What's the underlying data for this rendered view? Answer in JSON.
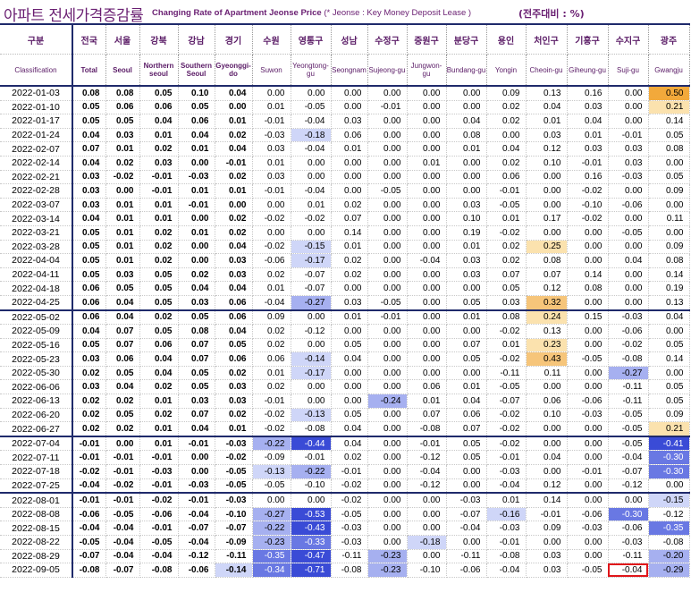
{
  "title": {
    "korean": "아파트 전세가격증감률",
    "english": "Changing Rate of Apartment Jeonse Price",
    "note": "(* Jeonse : Key Money Deposit Lease )",
    "unit": "(전주대비 : %)"
  },
  "columns": [
    {
      "ko": "구분",
      "en": "Classification"
    },
    {
      "ko": "전국",
      "en": "Total"
    },
    {
      "ko": "서울",
      "en": "Seoul"
    },
    {
      "ko": "강북",
      "en": "Northern seoul"
    },
    {
      "ko": "강남",
      "en": "Southern Seoul"
    },
    {
      "ko": "경기",
      "en": "Gyeonggi-do"
    },
    {
      "ko": "수원",
      "en": "Suwon"
    },
    {
      "ko": "영통구",
      "en": "Yeongtong-gu"
    },
    {
      "ko": "성남",
      "en": "Seongnam"
    },
    {
      "ko": "수정구",
      "en": "Sujeong-gu"
    },
    {
      "ko": "중원구",
      "en": "Jungwon-gu"
    },
    {
      "ko": "분당구",
      "en": "Bundang-gu"
    },
    {
      "ko": "용인",
      "en": "Yongin"
    },
    {
      "ko": "처인구",
      "en": "Cheoin-gu"
    },
    {
      "ko": "기흥구",
      "en": "Giheung-gu"
    },
    {
      "ko": "수지구",
      "en": "Suji-gu"
    },
    {
      "ko": "광주",
      "en": "Gwangju"
    }
  ],
  "rows": [
    [
      "2022-01-03",
      "0.08",
      "0.08",
      "0.05",
      "0.10",
      "0.04",
      "0.00",
      "0.00",
      "0.00",
      "0.00",
      "0.00",
      "0.00",
      "0.09",
      "0.13",
      "0.16",
      "0.00",
      "0.50"
    ],
    [
      "2022-01-10",
      "0.05",
      "0.06",
      "0.06",
      "0.05",
      "0.00",
      "0.01",
      "-0.05",
      "0.00",
      "-0.01",
      "0.00",
      "0.00",
      "0.02",
      "0.04",
      "0.03",
      "0.00",
      "0.21"
    ],
    [
      "2022-01-17",
      "0.05",
      "0.05",
      "0.04",
      "0.06",
      "0.01",
      "-0.01",
      "-0.04",
      "0.03",
      "0.00",
      "0.00",
      "0.04",
      "0.02",
      "0.01",
      "0.04",
      "0.00",
      "0.14"
    ],
    [
      "2022-01-24",
      "0.04",
      "0.03",
      "0.01",
      "0.04",
      "0.02",
      "-0.03",
      "-0.18",
      "0.06",
      "0.00",
      "0.00",
      "0.08",
      "0.00",
      "0.03",
      "0.01",
      "-0.01",
      "0.05"
    ],
    [
      "2022-02-07",
      "0.07",
      "0.01",
      "0.02",
      "0.01",
      "0.04",
      "0.03",
      "-0.04",
      "0.01",
      "0.00",
      "0.00",
      "0.01",
      "0.04",
      "0.12",
      "0.03",
      "0.03",
      "0.08"
    ],
    [
      "2022-02-14",
      "0.04",
      "0.02",
      "0.03",
      "0.00",
      "-0.01",
      "0.01",
      "0.00",
      "0.00",
      "0.00",
      "0.01",
      "0.00",
      "0.02",
      "0.10",
      "-0.01",
      "0.03",
      "0.00"
    ],
    [
      "2022-02-21",
      "0.03",
      "-0.02",
      "-0.01",
      "-0.03",
      "0.02",
      "0.03",
      "0.00",
      "0.00",
      "0.00",
      "0.00",
      "0.00",
      "0.06",
      "0.00",
      "0.16",
      "-0.03",
      "0.05"
    ],
    [
      "2022-02-28",
      "0.03",
      "0.00",
      "-0.01",
      "0.01",
      "0.01",
      "-0.01",
      "-0.04",
      "0.00",
      "-0.05",
      "0.00",
      "0.00",
      "-0.01",
      "0.00",
      "-0.02",
      "0.00",
      "0.09"
    ],
    [
      "2022-03-07",
      "0.03",
      "0.01",
      "0.01",
      "-0.01",
      "0.00",
      "0.00",
      "0.01",
      "0.02",
      "0.00",
      "0.00",
      "0.03",
      "-0.05",
      "0.00",
      "-0.10",
      "-0.06",
      "0.00"
    ],
    [
      "2022-03-14",
      "0.04",
      "0.01",
      "0.01",
      "0.00",
      "0.02",
      "-0.02",
      "-0.02",
      "0.07",
      "0.00",
      "0.00",
      "0.10",
      "0.01",
      "0.17",
      "-0.02",
      "0.00",
      "0.11"
    ],
    [
      "2022-03-21",
      "0.05",
      "0.01",
      "0.02",
      "0.01",
      "0.02",
      "0.00",
      "0.00",
      "0.14",
      "0.00",
      "0.00",
      "0.19",
      "-0.02",
      "0.00",
      "0.00",
      "-0.05",
      "0.00"
    ],
    [
      "2022-03-28",
      "0.05",
      "0.01",
      "0.02",
      "0.00",
      "0.04",
      "-0.02",
      "-0.15",
      "0.01",
      "0.00",
      "0.00",
      "0.01",
      "0.02",
      "0.25",
      "0.00",
      "0.00",
      "0.09"
    ],
    [
      "2022-04-04",
      "0.05",
      "0.01",
      "0.02",
      "0.00",
      "0.03",
      "-0.06",
      "-0.17",
      "0.02",
      "0.00",
      "-0.04",
      "0.03",
      "0.02",
      "0.08",
      "0.00",
      "0.04",
      "0.08"
    ],
    [
      "2022-04-11",
      "0.05",
      "0.03",
      "0.05",
      "0.02",
      "0.03",
      "0.02",
      "-0.07",
      "0.02",
      "0.00",
      "0.00",
      "0.03",
      "0.07",
      "0.07",
      "0.14",
      "0.00",
      "0.14"
    ],
    [
      "2022-04-18",
      "0.06",
      "0.05",
      "0.05",
      "0.04",
      "0.04",
      "0.01",
      "-0.07",
      "0.00",
      "0.00",
      "0.00",
      "0.00",
      "0.05",
      "0.12",
      "0.08",
      "0.00",
      "0.19"
    ],
    [
      "2022-04-25",
      "0.06",
      "0.04",
      "0.05",
      "0.03",
      "0.06",
      "-0.04",
      "-0.27",
      "0.03",
      "-0.05",
      "0.00",
      "0.05",
      "0.03",
      "0.32",
      "0.00",
      "0.00",
      "0.13"
    ],
    [
      "2022-05-02",
      "0.06",
      "0.04",
      "0.02",
      "0.05",
      "0.06",
      "0.09",
      "0.00",
      "0.01",
      "-0.01",
      "0.00",
      "0.01",
      "0.08",
      "0.24",
      "0.15",
      "-0.03",
      "0.04"
    ],
    [
      "2022-05-09",
      "0.04",
      "0.07",
      "0.05",
      "0.08",
      "0.04",
      "0.02",
      "-0.12",
      "0.00",
      "0.00",
      "0.00",
      "0.00",
      "-0.02",
      "0.13",
      "0.00",
      "-0.06",
      "0.00"
    ],
    [
      "2022-05-16",
      "0.05",
      "0.07",
      "0.06",
      "0.07",
      "0.05",
      "0.02",
      "0.00",
      "0.05",
      "0.00",
      "0.00",
      "0.07",
      "0.01",
      "0.23",
      "0.00",
      "-0.02",
      "0.05"
    ],
    [
      "2022-05-23",
      "0.03",
      "0.06",
      "0.04",
      "0.07",
      "0.06",
      "0.06",
      "-0.14",
      "0.04",
      "0.00",
      "0.00",
      "0.05",
      "-0.02",
      "0.43",
      "-0.05",
      "-0.08",
      "0.14"
    ],
    [
      "2022-05-30",
      "0.02",
      "0.05",
      "0.04",
      "0.05",
      "0.02",
      "0.01",
      "-0.17",
      "0.00",
      "0.00",
      "0.00",
      "0.00",
      "-0.11",
      "0.11",
      "0.00",
      "-0.27",
      "0.00"
    ],
    [
      "2022-06-06",
      "0.03",
      "0.04",
      "0.02",
      "0.05",
      "0.03",
      "0.02",
      "0.00",
      "0.00",
      "0.00",
      "0.06",
      "0.01",
      "-0.05",
      "0.00",
      "0.00",
      "-0.11",
      "0.05"
    ],
    [
      "2022-06-13",
      "0.02",
      "0.02",
      "0.01",
      "0.03",
      "0.03",
      "-0.01",
      "0.00",
      "0.00",
      "-0.24",
      "0.01",
      "0.04",
      "-0.07",
      "0.06",
      "-0.06",
      "-0.11",
      "0.05"
    ],
    [
      "2022-06-20",
      "0.02",
      "0.05",
      "0.02",
      "0.07",
      "0.02",
      "-0.02",
      "-0.13",
      "0.05",
      "0.00",
      "0.07",
      "0.06",
      "-0.02",
      "0.10",
      "-0.03",
      "-0.05",
      "0.09"
    ],
    [
      "2022-06-27",
      "0.02",
      "0.02",
      "0.01",
      "0.04",
      "0.01",
      "-0.02",
      "-0.08",
      "0.04",
      "0.00",
      "-0.08",
      "0.07",
      "-0.02",
      "0.00",
      "0.00",
      "-0.05",
      "0.21"
    ],
    [
      "2022-07-04",
      "-0.01",
      "0.00",
      "0.01",
      "-0.01",
      "-0.03",
      "-0.22",
      "-0.44",
      "0.04",
      "0.00",
      "-0.01",
      "0.05",
      "-0.02",
      "0.00",
      "0.00",
      "-0.05",
      "-0.41"
    ],
    [
      "2022-07-11",
      "-0.01",
      "-0.01",
      "-0.01",
      "0.00",
      "-0.02",
      "-0.09",
      "-0.01",
      "0.02",
      "0.00",
      "-0.12",
      "0.05",
      "-0.01",
      "0.04",
      "0.00",
      "-0.04",
      "-0.30"
    ],
    [
      "2022-07-18",
      "-0.02",
      "-0.01",
      "-0.03",
      "0.00",
      "-0.05",
      "-0.13",
      "-0.22",
      "-0.01",
      "0.00",
      "-0.04",
      "0.00",
      "-0.03",
      "0.00",
      "-0.01",
      "-0.07",
      "-0.30"
    ],
    [
      "2022-07-25",
      "-0.04",
      "-0.02",
      "-0.01",
      "-0.03",
      "-0.05",
      "-0.05",
      "-0.10",
      "-0.02",
      "0.00",
      "-0.12",
      "0.00",
      "-0.04",
      "0.12",
      "0.00",
      "-0.12",
      "0.00"
    ],
    [
      "2022-08-01",
      "-0.01",
      "-0.01",
      "-0.02",
      "-0.01",
      "-0.03",
      "0.00",
      "0.00",
      "-0.02",
      "0.00",
      "0.00",
      "-0.03",
      "0.01",
      "0.14",
      "0.00",
      "0.00",
      "-0.15"
    ],
    [
      "2022-08-08",
      "-0.06",
      "-0.05",
      "-0.06",
      "-0.04",
      "-0.10",
      "-0.27",
      "-0.53",
      "-0.05",
      "0.00",
      "0.00",
      "-0.07",
      "-0.16",
      "-0.01",
      "-0.06",
      "-0.30",
      "-0.12"
    ],
    [
      "2022-08-15",
      "-0.04",
      "-0.04",
      "-0.01",
      "-0.07",
      "-0.07",
      "-0.22",
      "-0.43",
      "-0.03",
      "0.00",
      "0.00",
      "-0.04",
      "-0.03",
      "0.09",
      "-0.03",
      "-0.06",
      "-0.35"
    ],
    [
      "2022-08-22",
      "-0.05",
      "-0.04",
      "-0.05",
      "-0.04",
      "-0.09",
      "-0.23",
      "-0.33",
      "-0.03",
      "0.00",
      "-0.18",
      "0.00",
      "-0.01",
      "0.00",
      "0.00",
      "-0.03",
      "-0.08"
    ],
    [
      "2022-08-29",
      "-0.07",
      "-0.04",
      "-0.04",
      "-0.12",
      "-0.11",
      "-0.35",
      "-0.47",
      "-0.11",
      "-0.23",
      "0.00",
      "-0.11",
      "-0.08",
      "0.03",
      "0.00",
      "-0.11",
      "-0.20"
    ],
    [
      "2022-09-05",
      "-0.08",
      "-0.07",
      "-0.08",
      "-0.06",
      "-0.14",
      "-0.34",
      "-0.71",
      "-0.08",
      "-0.23",
      "-0.10",
      "-0.06",
      "-0.04",
      "0.03",
      "-0.05",
      "-0.04",
      "-0.29"
    ]
  ],
  "colors": {
    "heading": "#6a1f72",
    "rule": "#1f2a6b",
    "highlight_border": "#e0151a"
  },
  "highlighted_cell": {
    "row": 34,
    "col": 15
  }
}
